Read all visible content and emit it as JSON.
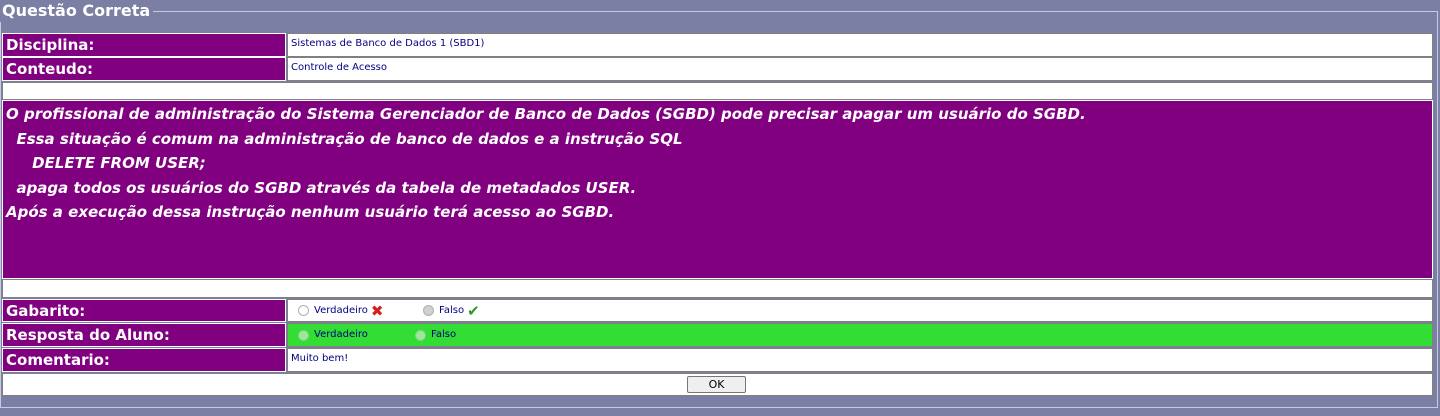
{
  "panel_title": "Questão Correta",
  "disciplina": {
    "label": "Disciplina:",
    "value": "Sistemas de Banco de Dados 1 (SBD1)"
  },
  "conteudo": {
    "label": "Conteudo:",
    "value": "Controle de Acesso"
  },
  "question": {
    "lines": [
      "O profissional de administração do Sistema Gerenciador de Banco de Dados (SGBD) pode precisar apagar um usuário do SGBD.",
      "  Essa situação é comum na administração de banco de dados e a instrução SQL",
      "",
      "     DELETE FROM USER;",
      "",
      "  apaga todos os usuários do SGBD através da tabela de metadados USER.",
      "",
      "Após a execução dessa instrução nenhum usuário terá acesso ao SGBD."
    ]
  },
  "gabarito": {
    "label": "Gabarito:",
    "options": [
      {
        "text": "Verdadeiro",
        "checked": false,
        "mark": "x-icon"
      },
      {
        "text": "Falso",
        "checked": true,
        "mark": "check-icon"
      }
    ]
  },
  "resposta": {
    "label": "Resposta do Aluno:",
    "highlight_color": "#33dd33",
    "options": [
      {
        "text": "Verdadeiro",
        "checked": false
      },
      {
        "text": "Falso",
        "checked": true
      }
    ]
  },
  "comentario": {
    "label": "Comentario:",
    "value": "Muito bem!"
  },
  "ok_button": "OK",
  "colors": {
    "label_bg": "#800080",
    "page_bg": "#7a7fa3",
    "correct_green": "#33dd33"
  }
}
